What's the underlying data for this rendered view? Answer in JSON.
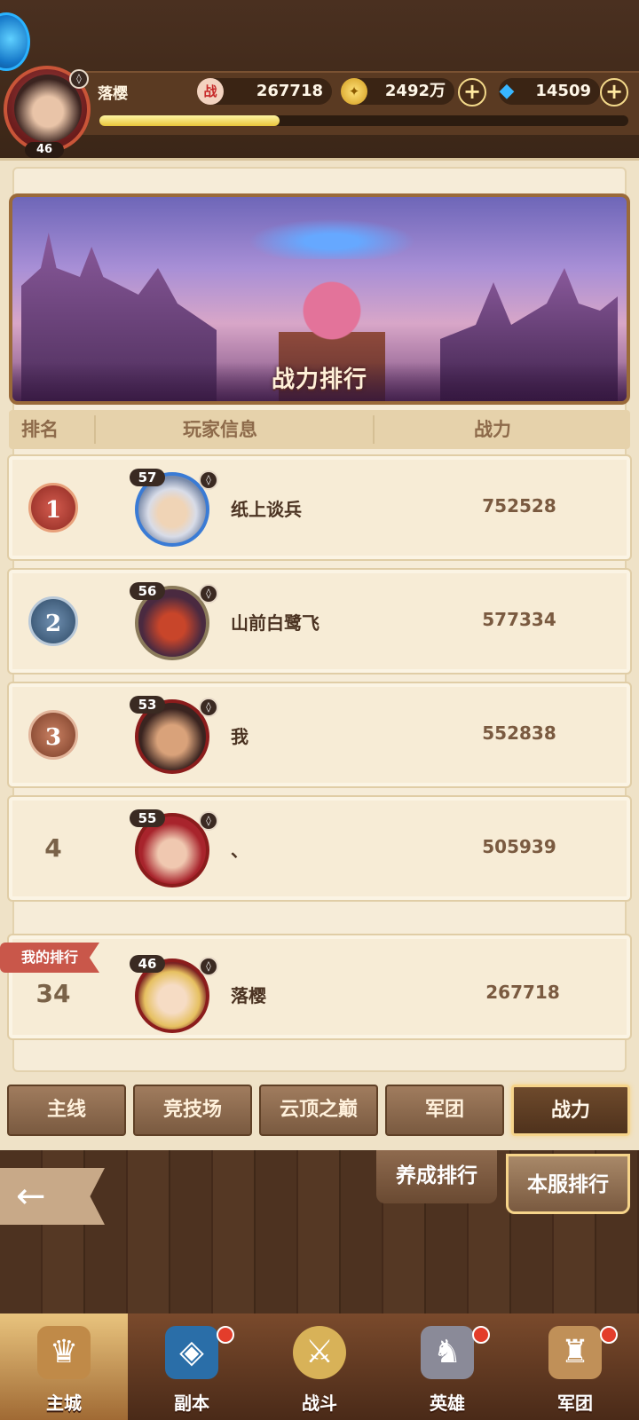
{
  "header": {
    "player_name": "落樱",
    "player_level": "46",
    "exp_fraction": 0.34,
    "power_icon": "战",
    "power": "267718",
    "gold": "2492万",
    "diamonds": "14509",
    "plus_symbol": "+"
  },
  "banner": {
    "title": "战力排行"
  },
  "columns": {
    "rank": "排名",
    "player": "玩家信息",
    "power": "战力"
  },
  "rows": [
    {
      "rank": "1",
      "level": "57",
      "name": "纸上谈兵",
      "power": "752528",
      "medal_color": "#b8453a"
    },
    {
      "rank": "2",
      "level": "56",
      "name": "山前白鹭飞",
      "power": "577334",
      "medal_color": "#4a6e8e"
    },
    {
      "rank": "3",
      "level": "53",
      "name": "我",
      "power": "552838",
      "medal_color": "#a4583e"
    },
    {
      "rank": "4",
      "level": "55",
      "name": "、",
      "power": "505939"
    }
  ],
  "my_rank": {
    "tag": "我的排行",
    "rank": "34",
    "level": "46",
    "name": "落樱",
    "power": "267718"
  },
  "tabs": [
    "主线",
    "竞技场",
    "云顶之巅",
    "军团",
    "战力"
  ],
  "active_tab": "战力",
  "rank_type_tabs": {
    "cultivate": "养成排行",
    "server": "本服排行"
  },
  "back_arrow": "←",
  "nav": [
    {
      "label": "主城",
      "icon": "castle-icon",
      "glyph": "♛"
    },
    {
      "label": "副本",
      "icon": "portal-icon",
      "glyph": "◈"
    },
    {
      "label": "战斗",
      "icon": "sword-icon",
      "glyph": "⚔"
    },
    {
      "label": "英雄",
      "icon": "knight-icon",
      "glyph": "♞"
    },
    {
      "label": "军团",
      "icon": "banner-icon",
      "glyph": "♜"
    }
  ],
  "colors": {
    "accent_gold": "#f6d48a",
    "panel_bg": "#f6ecd8",
    "badge_red": "#e33d2b"
  }
}
